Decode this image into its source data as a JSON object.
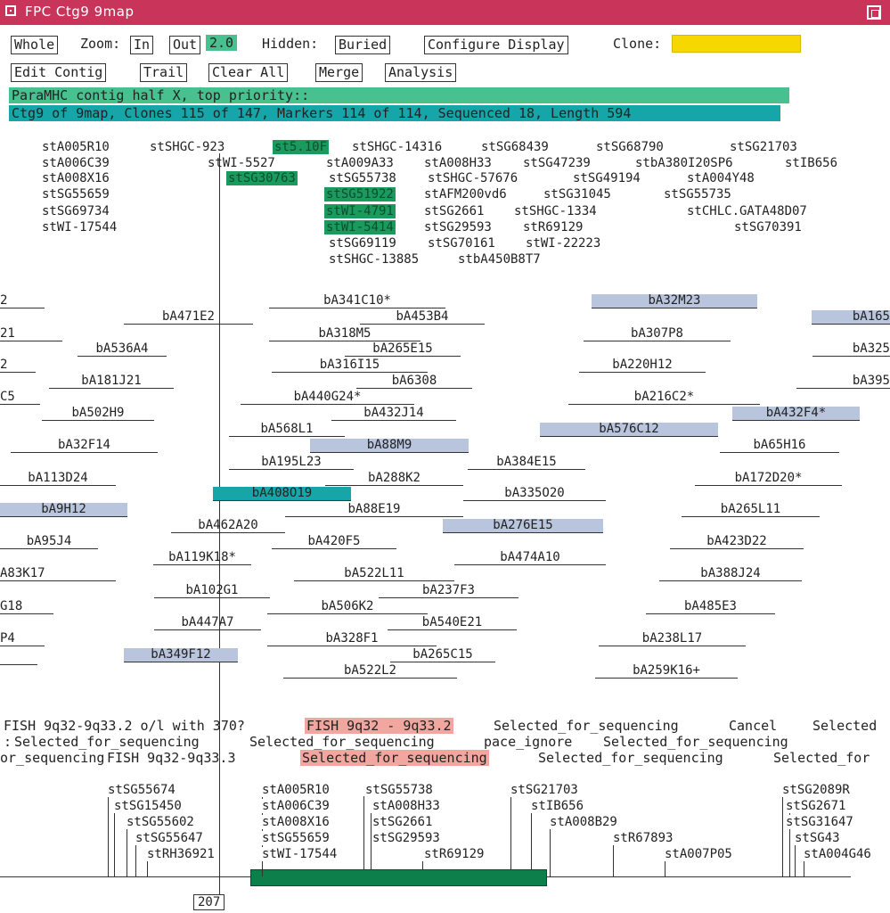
{
  "window": {
    "title": "FPC Ctg9 9map"
  },
  "toolbar": {
    "whole": "Whole",
    "zoom_label": "Zoom:",
    "zoom_in": "In",
    "zoom_out": "Out",
    "zoom_value": "2.0",
    "hidden_label": "Hidden:",
    "buried": "Buried",
    "configure_display": "Configure Display",
    "clone_label": "Clone:",
    "clone_value": "",
    "edit_contig": "Edit Contig",
    "trail": "Trail",
    "clear_all": "Clear All",
    "merge": "Merge",
    "analysis": "Analysis"
  },
  "info": {
    "priority": "ParaMHC contig half X, top priority::",
    "summary": "Ctg9 of 9map, Clones 115 of 147, Markers 114 of 114, Sequenced 18, Length 594"
  },
  "markers_top": [
    "stA005R10",
    "stSHGC-923",
    "st5.10F",
    "stSHGC-14316",
    "stSG68439",
    "stSG68790",
    "stSG21703",
    "stA006C39",
    "stWI-5527",
    "stA009A33",
    "stA008H33",
    "stSG47239",
    "stbA380I20SP6",
    "stIB656",
    "stA008X16",
    "stSG30763",
    "stSG55738",
    "stSHGC-57676",
    "stSG49194",
    "stA004Y48",
    "stSG55659",
    "stSG51922",
    "stAFM200vd6",
    "stSG31045",
    "stSG55735",
    "stSG69734",
    "stWI-4791",
    "stSG2661",
    "stSHGC-1334",
    "stCHLC.GATA48D07",
    "stWI-17544",
    "stWI-5414",
    "stSG29593",
    "stR69129",
    "stSG70391",
    "stSG69119",
    "stSG70161",
    "stWI-22223",
    "stSHGC-13885",
    "stbA450B8T7"
  ],
  "clones": [
    "2",
    "bA341C10*",
    "bA32M23",
    "bA471E2",
    "bA453B4",
    "bA165",
    "21",
    "bA318M5",
    "bA307P8",
    "bA536A4",
    "bA265E15",
    "bA325",
    "2",
    "bA316I15",
    "bA220H12",
    "bA181J21",
    "bA6308",
    "bA395",
    "C5",
    "bA440G24*",
    "bA216C2*",
    "bA502H9",
    "bA432J14",
    "bA432F4*",
    "bA568L1",
    "bA576C12",
    "bA32F14",
    "bA88M9",
    "bA65H16",
    "bA195L23",
    "bA384E15",
    "bA113D24",
    "bA288K2",
    "bA172D20*",
    "bA408O19",
    "bA335O20",
    "bA9H12",
    "bA88E19",
    "bA265L11",
    "bA462A20",
    "bA276E15",
    "bA95J4",
    "bA420F5",
    "bA423D22",
    "bA119K18*",
    "bA474A10",
    "A83K17",
    "bA522L11",
    "bA388J24",
    "bA102G1",
    "bA237F3",
    "G18",
    "bA506K2",
    "bA485E3",
    "bA447A7",
    "bA540E21",
    "P4",
    "bA328F1",
    "bA238L17",
    "bA349F12",
    "bA265C15",
    "bA522L2",
    "bA259K16+"
  ],
  "remarks": [
    "FISH 9q32-9q33.2 o/l with 370?",
    "FISH 9q32 - 9q33.2",
    "Selected_for_sequencing",
    "Cancel",
    "Selected",
    "Selected_for_sequencing",
    "Selected_for_sequencing",
    "pace_ignore",
    "Selected_for_sequencing",
    "or_sequencing",
    "FISH 9q32-9q33.3",
    "Selected_for_sequencing",
    "Selected_for_sequencing",
    "Selected_for"
  ],
  "markers_bottom": [
    "stSG55674",
    "stSG15450",
    "stSG55602",
    "stSG55647",
    "stRH36921",
    "stA005R10",
    "stA006C39",
    "stA008X16",
    "stSG55659",
    "stWI-17544",
    "stSG55738",
    "stA008H33",
    "stSG2661",
    "stSG29593",
    "stR69129",
    "stSG21703",
    "stIB656",
    "stA008B29",
    "stR67893",
    "stA007P05",
    "stSG2089R",
    "stSG2671",
    "stSG31647",
    "stSG43",
    "stA004G46"
  ],
  "position": "207",
  "colors": {
    "title": "#c8345a",
    "green": "#48c08f",
    "teal": "#16a5a8",
    "blue": "#b9c4dd",
    "pink": "#f2a6a0",
    "yellow": "#f6d800",
    "seq": "#0d7f4a"
  }
}
